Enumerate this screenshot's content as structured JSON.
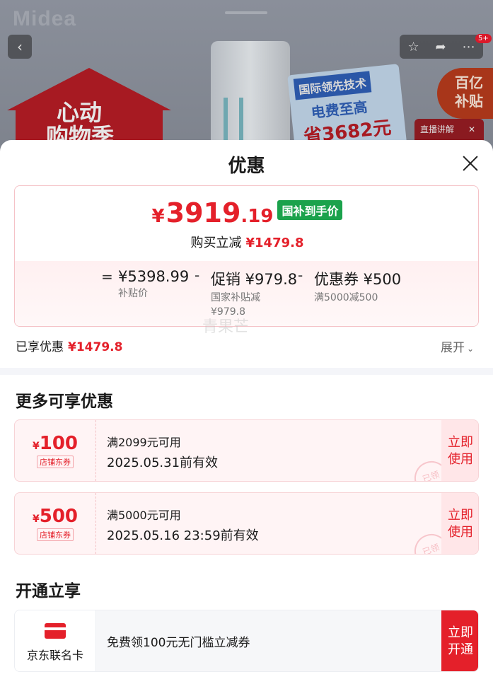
{
  "background": {
    "brand": "Midea",
    "notification_badge": "5+",
    "promo_house_line1": "心动",
    "promo_house_line2": "购物季",
    "promo_panel_line1": "国际领先技术",
    "promo_panel_line2": "电费至高",
    "promo_panel_line3": "省3682元",
    "subsidy_line1": "百亿",
    "subsidy_line2": "补贴",
    "live_label": "直播讲解"
  },
  "sheet": {
    "title": "优惠",
    "final_price": {
      "currency": "¥",
      "integer": "3919",
      "decimal": ".19",
      "tag": "国补到手价"
    },
    "instant_reduction_label": "购买立减",
    "instant_reduction_amount": "¥1479.8",
    "breakdown": {
      "eq_op": "=",
      "base_value": "¥5398.99",
      "base_label": "补贴价",
      "minus_op_1": "-",
      "promo_value": "促销 ¥979.8",
      "promo_sub_1": "国家补贴减",
      "promo_sub_2": "¥979.8",
      "minus_op_2": "-",
      "coupon_value": "优惠券 ¥500",
      "coupon_sub": "满5000减500"
    },
    "enjoyed_label": "已享优惠",
    "enjoyed_amount": "¥1479.8",
    "expand_label": "展开",
    "watermark": "青果芒",
    "more_title": "更多可享优惠",
    "coupons": [
      {
        "currency": "¥",
        "amount": "100",
        "kind": "店铺东券",
        "condition": "满2099元可用",
        "valid": "2025.05.31前有效",
        "btn_line1": "立即",
        "btn_line2": "使用",
        "stamp": "已领"
      },
      {
        "currency": "¥",
        "amount": "500",
        "kind": "店铺东券",
        "condition": "满5000元可用",
        "valid": "2025.05.16 23:59前有效",
        "btn_line1": "立即",
        "btn_line2": "使用",
        "stamp": "已领"
      }
    ],
    "open_title": "开通立享",
    "card_offer": {
      "card_name": "京东联名卡",
      "description": "免费领100元无门槛立减券",
      "btn_line1": "立即",
      "btn_line2": "开通"
    }
  },
  "colors": {
    "accent_red": "#e4202a",
    "green_tag": "#1ba24c",
    "pink_bg": "#fff4f5"
  }
}
